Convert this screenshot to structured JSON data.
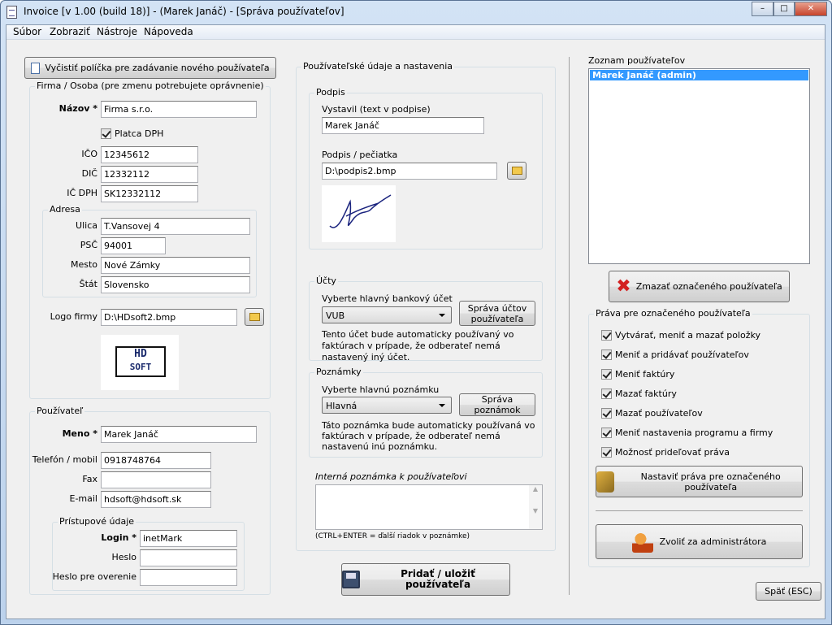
{
  "window": {
    "title": "Invoice [v 1.00 (build 18)]  -  (Marek Janáč) - [Správa používateľov]",
    "minimize": "–",
    "maximize": "□",
    "close": "✕"
  },
  "menu": [
    "Súbor",
    "Zobraziť",
    "Nástroje",
    "Nápoveda"
  ],
  "left": {
    "clear_button": "Vyčistiť políčka pre zadávanie nového používateľa",
    "firma_group": "Firma / Osoba (pre zmenu potrebujete oprávnenie)",
    "nazov_label": "Názov *",
    "nazov": "Firma s.r.o.",
    "platca_dph": "Platca DPH",
    "ico_label": "IČO",
    "ico": "12345612",
    "dic_label": "DIČ",
    "dic": "12332112",
    "icdph_label": "IČ DPH",
    "icdph": "SK12332112",
    "adresa_group": "Adresa",
    "ulica_label": "Ulica",
    "ulica": "T.Vansovej 4",
    "psc_label": "PSČ",
    "psc": "94001",
    "mesto_label": "Mesto",
    "mesto": "Nové Zámky",
    "stat_label": "Štát",
    "stat": "Slovensko",
    "logo_label": "Logo firmy",
    "logo": "D:\\HDsoft2.bmp",
    "logo_text_top": "HD",
    "logo_text_bottom": "SOFT",
    "user_group": "Používateľ",
    "meno_label": "Meno *",
    "meno": "Marek Janáč",
    "telefon_label": "Telefón / mobil",
    "telefon": "0918748764",
    "fax_label": "Fax",
    "fax": "",
    "email_label": "E-mail",
    "email": "hdsoft@hdsoft.sk",
    "access_group": "Prístupové údaje",
    "login_label": "Login *",
    "login": "inetMark",
    "heslo_label": "Heslo",
    "heslo": "",
    "heslo2_label": "Heslo pre overenie",
    "heslo2": ""
  },
  "middle": {
    "group": "Používateľské údaje a nastavenia",
    "podpis_group": "Podpis",
    "vystavil_label": "Vystavil (text v podpise)",
    "vystavil": "Marek Janáč",
    "pecatka_label": "Podpis / pečiatka",
    "pecatka": "D:\\podpis2.bmp",
    "ucty_group": "Účty",
    "ucet_label": "Vyberte hlavný bankový účet",
    "ucet": "VUB",
    "ucty_button": "Správa účtov používateľa",
    "ucty_info": "Tento účet bude automaticky používaný vo faktúrach v prípade, že odberateľ nemá nastavený iný účet.",
    "poznamky_group": "Poznámky",
    "poznamka_label": "Vyberte hlavnú poznámku",
    "poznamka": "Hlavná",
    "poznamky_button": "Správa poznámok",
    "poznamky_info": "Táto poznámka bude automaticky používaná vo faktúrach v prípade, že odberateľ nemá nastavenú inú poznámku.",
    "interna_label": "Interná poznámka k používateľovi",
    "interna": "",
    "hint": "(CTRL+ENTER = ďalší riadok v poznámke)",
    "save_button": "Pridať / uložiť používateľa"
  },
  "right": {
    "list_label": "Zoznam používateľov",
    "users": [
      "Marek Janáč (admin)"
    ],
    "delete_button": "Zmazať označeného používateľa",
    "rights_group": "Práva pre označeného používateľa",
    "rights": [
      "Vytvárať, meniť a mazať položky",
      "Meniť a pridávať používateľov",
      "Meniť faktúry",
      "Mazať faktúry",
      "Mazať používateľov",
      "Meniť nastavenia programu a firmy",
      "Možnosť prideľovať práva"
    ],
    "set_rights_button": "Nastaviť práva pre označeného používateľa",
    "admin_button": "Zvoliť za administrátora",
    "back_button": "Späť (ESC)"
  }
}
